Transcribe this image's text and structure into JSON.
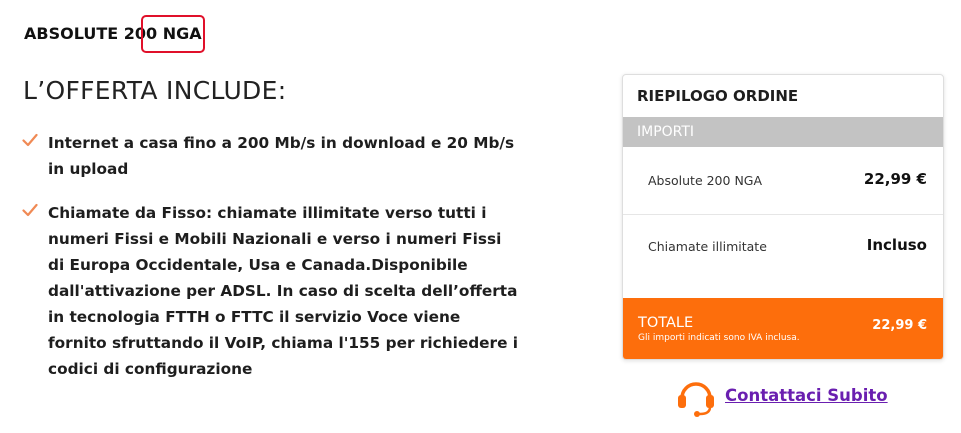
{
  "product": {
    "title": "ABSOLUTE 200 NGA"
  },
  "offer": {
    "heading": "L’OFFERTA INCLUDE:",
    "features": [
      {
        "text": "Internet a casa fino a 200 Mb/s in download e 20 Mb/s in upload"
      },
      {
        "text": "Chiamate da Fisso: chiamate illimitate verso tutti i numeri Fissi e Mobili Nazionali e verso i numeri Fissi di Europa Occidentale, Usa e Canada.Disponibile dall'attivazione per ADSL. In caso di scelta dell’offerta in tecnologia FTTH o FTTC il servizio Voce viene fornito sfruttando il VoIP, chiama l'155 per richiedere i codici di configurazione"
      }
    ]
  },
  "summary": {
    "title": "RIEPILOGO ORDINE",
    "section_label": "IMPORTI",
    "rows": [
      {
        "label": "Absolute 200 NGA",
        "value": "22,99 €"
      },
      {
        "label": "Chiamate illimitate",
        "value": "Incluso"
      }
    ],
    "total": {
      "label": "TOTALE",
      "note": "Gli importi indicati sono IVA inclusa.",
      "value": "22,99 €"
    }
  },
  "contact": {
    "link_text": "Contattaci Subito"
  },
  "colors": {
    "accent_orange": "#fd6e0c",
    "check_orange": "#f08a55",
    "annotation_red": "#e0102a",
    "link_purple": "#6a1fb0",
    "section_gray": "#c3c3c3"
  }
}
